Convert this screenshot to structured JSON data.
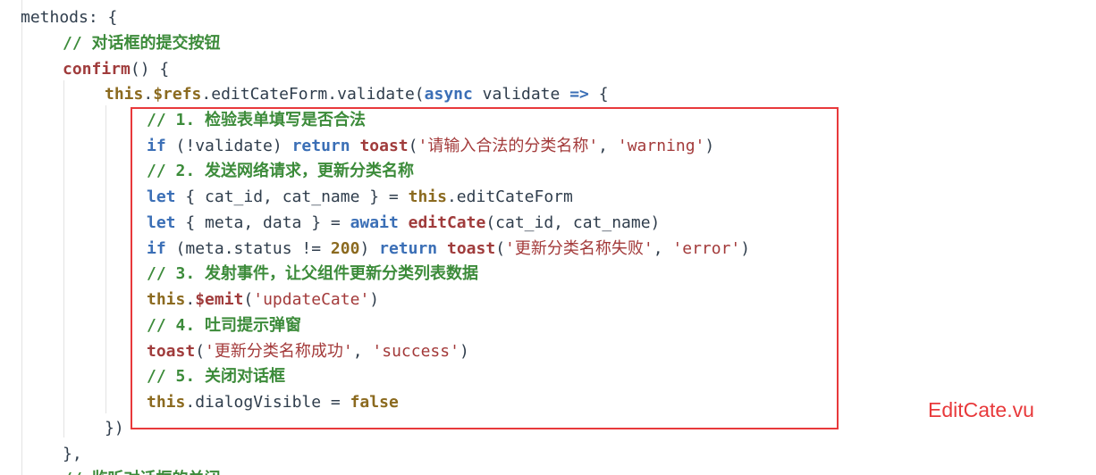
{
  "editor": {
    "lines": [
      {
        "tokens": [
          {
            "t": "methods",
            "c": "ident"
          },
          {
            "t": ": {",
            "c": "plain"
          }
        ]
      },
      {
        "tokens": [
          {
            "t": "// 对话框的提交按钮",
            "c": "comment"
          }
        ]
      },
      {
        "tokens": [
          {
            "t": "confirm",
            "c": "func"
          },
          {
            "t": "() {",
            "c": "plain"
          }
        ]
      },
      {
        "tokens": [
          {
            "t": "this",
            "c": "this"
          },
          {
            "t": ".",
            "c": "plain"
          },
          {
            "t": "$refs",
            "c": "this"
          },
          {
            "t": ".editCateForm.validate(",
            "c": "plain"
          },
          {
            "t": "async",
            "c": "keyword"
          },
          {
            "t": " validate ",
            "c": "plain"
          },
          {
            "t": "=>",
            "c": "keyword"
          },
          {
            "t": " {",
            "c": "plain"
          }
        ]
      },
      {
        "tokens": [
          {
            "t": "// 1. 检验表单填写是否合法",
            "c": "comment"
          }
        ]
      },
      {
        "tokens": [
          {
            "t": "if",
            "c": "keyword"
          },
          {
            "t": " (!validate) ",
            "c": "plain"
          },
          {
            "t": "return",
            "c": "keyword"
          },
          {
            "t": " ",
            "c": "plain"
          },
          {
            "t": "toast",
            "c": "func"
          },
          {
            "t": "(",
            "c": "plain"
          },
          {
            "t": "'请输入合法的分类名称'",
            "c": "string"
          },
          {
            "t": ", ",
            "c": "plain"
          },
          {
            "t": "'warning'",
            "c": "string"
          },
          {
            "t": ")",
            "c": "plain"
          }
        ]
      },
      {
        "tokens": [
          {
            "t": "// 2. 发送网络请求，更新分类名称",
            "c": "comment"
          }
        ]
      },
      {
        "tokens": [
          {
            "t": "let",
            "c": "keyword"
          },
          {
            "t": " { cat_id, cat_name } = ",
            "c": "plain"
          },
          {
            "t": "this",
            "c": "this"
          },
          {
            "t": ".editCateForm",
            "c": "plain"
          }
        ]
      },
      {
        "tokens": [
          {
            "t": "let",
            "c": "keyword"
          },
          {
            "t": " { meta, data } = ",
            "c": "plain"
          },
          {
            "t": "await",
            "c": "keyword"
          },
          {
            "t": " ",
            "c": "plain"
          },
          {
            "t": "editCate",
            "c": "func"
          },
          {
            "t": "(cat_id, cat_name)",
            "c": "plain"
          }
        ]
      },
      {
        "tokens": [
          {
            "t": "if",
            "c": "keyword"
          },
          {
            "t": " (meta.status != ",
            "c": "plain"
          },
          {
            "t": "200",
            "c": "number"
          },
          {
            "t": ") ",
            "c": "plain"
          },
          {
            "t": "return",
            "c": "keyword"
          },
          {
            "t": " ",
            "c": "plain"
          },
          {
            "t": "toast",
            "c": "func"
          },
          {
            "t": "(",
            "c": "plain"
          },
          {
            "t": "'更新分类名称失败'",
            "c": "string"
          },
          {
            "t": ", ",
            "c": "plain"
          },
          {
            "t": "'error'",
            "c": "string"
          },
          {
            "t": ")",
            "c": "plain"
          }
        ]
      },
      {
        "tokens": [
          {
            "t": "// 3. 发射事件，让父组件更新分类列表数据",
            "c": "comment"
          }
        ]
      },
      {
        "tokens": [
          {
            "t": "this",
            "c": "this"
          },
          {
            "t": ".",
            "c": "plain"
          },
          {
            "t": "$emit",
            "c": "func"
          },
          {
            "t": "(",
            "c": "plain"
          },
          {
            "t": "'updateCate'",
            "c": "string"
          },
          {
            "t": ")",
            "c": "plain"
          }
        ]
      },
      {
        "tokens": [
          {
            "t": "// 4. 吐司提示弹窗",
            "c": "comment"
          }
        ]
      },
      {
        "tokens": [
          {
            "t": "toast",
            "c": "func"
          },
          {
            "t": "(",
            "c": "plain"
          },
          {
            "t": "'更新分类名称成功'",
            "c": "string"
          },
          {
            "t": ", ",
            "c": "plain"
          },
          {
            "t": "'success'",
            "c": "string"
          },
          {
            "t": ")",
            "c": "plain"
          }
        ]
      },
      {
        "tokens": [
          {
            "t": "// 5. 关闭对话框",
            "c": "comment"
          }
        ]
      },
      {
        "tokens": [
          {
            "t": "this",
            "c": "this"
          },
          {
            "t": ".dialogVisible = ",
            "c": "plain"
          },
          {
            "t": "false",
            "c": "number"
          }
        ]
      },
      {
        "tokens": [
          {
            "t": "})",
            "c": "plain"
          }
        ]
      },
      {
        "tokens": [
          {
            "t": "},",
            "c": "plain"
          }
        ]
      },
      {
        "tokens": [
          {
            "t": "// 监听对话框的关闭",
            "c": "comment"
          }
        ]
      }
    ]
  },
  "annotation": {
    "filename": "EditCate.vu",
    "box_color": "#e8393b"
  },
  "colors": {
    "comment": "#3c8b3a",
    "keyword": "#3b6fb6",
    "function": "#a03c3c",
    "string": "#a33a3a",
    "this": "#8b6a1f",
    "plain": "#2f3d4c",
    "background": "#ffffff"
  }
}
